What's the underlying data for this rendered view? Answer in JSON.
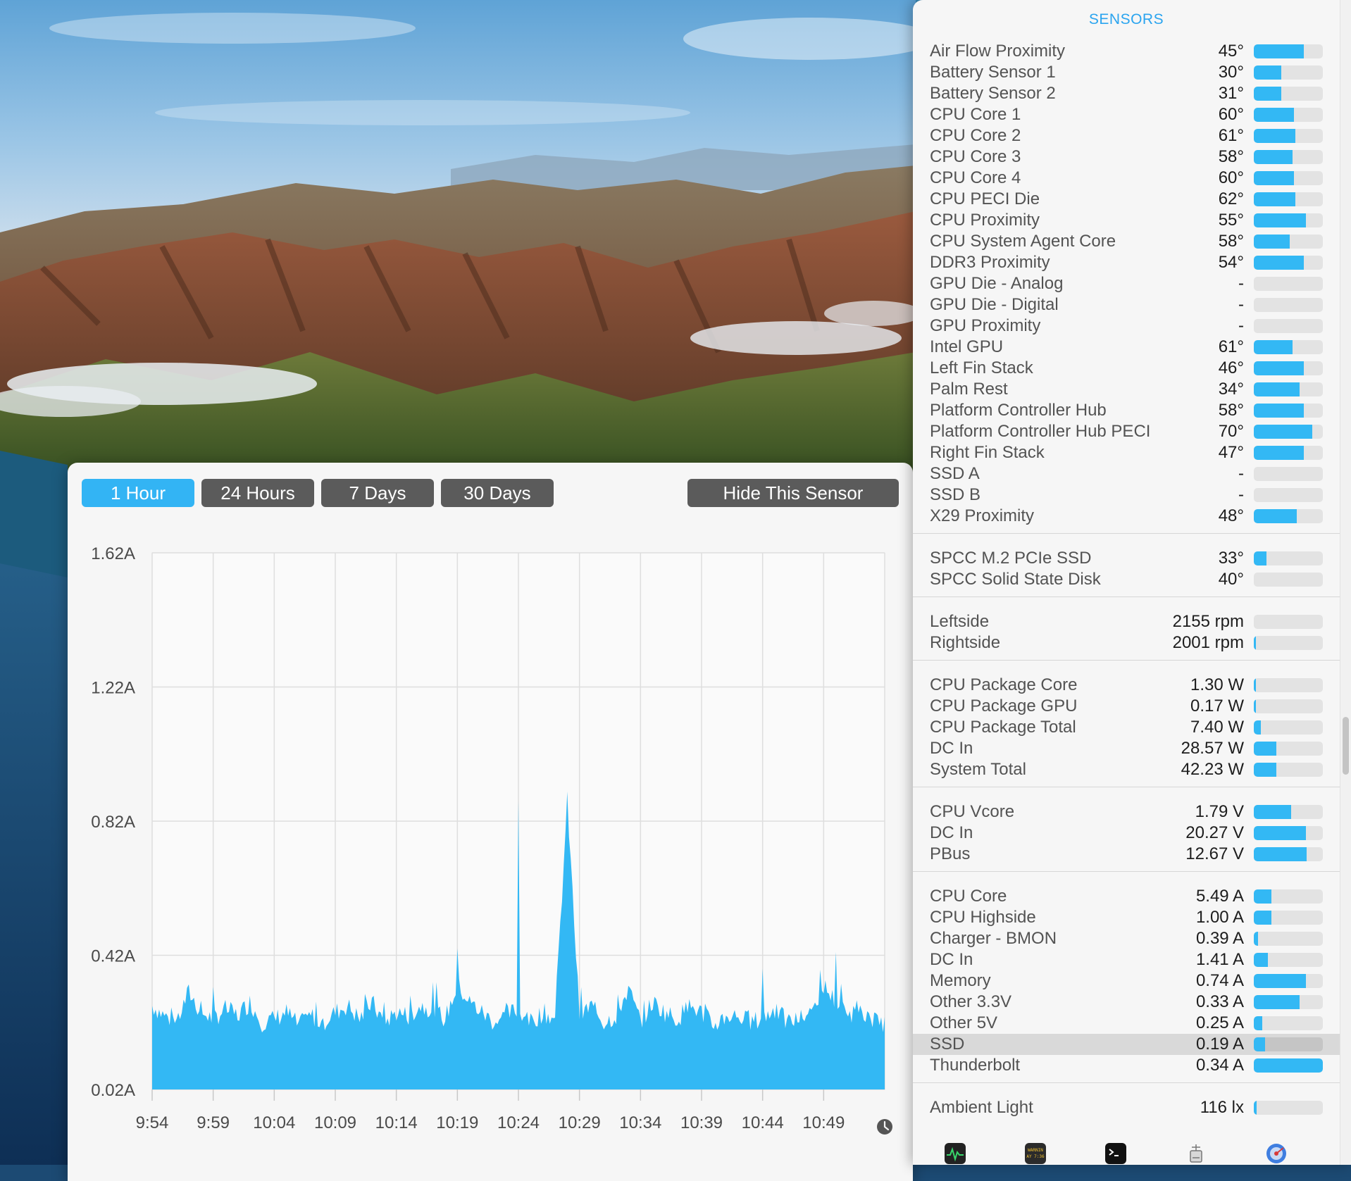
{
  "graph": {
    "range_buttons": [
      {
        "label": "1 Hour",
        "active": true
      },
      {
        "label": "24 Hours",
        "active": false
      },
      {
        "label": "7 Days",
        "active": false
      },
      {
        "label": "30 Days",
        "active": false
      }
    ],
    "hide_sensor_label": "Hide This Sensor",
    "y_ticks": [
      "1.62A",
      "1.22A",
      "0.82A",
      "0.42A",
      "0.02A"
    ],
    "x_ticks": [
      "9:54",
      "9:59",
      "10:04",
      "10:09",
      "10:14",
      "10:19",
      "10:24",
      "10:29",
      "10:34",
      "10:39",
      "10:44",
      "10:49"
    ],
    "clock_icon": "clock-icon",
    "fill_color": "#33b8f4"
  },
  "chart_data": {
    "type": "area",
    "title": "",
    "xlabel": "",
    "ylabel": "",
    "x_range": [
      "9:54",
      "10:54"
    ],
    "ylim": [
      0.02,
      1.62
    ],
    "unit": "A",
    "grid": true,
    "series": [
      {
        "x_minutes_from_start": [
          0,
          1,
          2,
          3,
          4,
          5,
          6,
          7,
          8,
          9,
          10,
          11,
          12,
          13,
          14,
          15,
          16,
          17,
          18,
          19,
          20,
          21,
          22,
          23,
          24,
          25,
          26,
          27,
          28,
          29,
          30,
          31,
          32,
          33,
          34,
          35,
          36,
          37,
          38,
          39,
          40,
          41,
          42,
          43,
          44,
          45,
          46,
          47,
          48,
          49,
          50,
          51,
          52,
          53,
          54,
          55,
          56,
          57,
          58,
          59,
          60
        ],
        "values": [
          0.27,
          0.24,
          0.22,
          0.31,
          0.25,
          0.23,
          0.26,
          0.24,
          0.28,
          0.22,
          0.23,
          0.25,
          0.21,
          0.24,
          0.22,
          0.25,
          0.27,
          0.23,
          0.28,
          0.22,
          0.25,
          0.24,
          0.27,
          0.26,
          0.23,
          0.33,
          0.28,
          0.25,
          0.22,
          0.24,
          0.26,
          0.22,
          0.25,
          0.23,
          0.88,
          0.24,
          0.27,
          0.22,
          0.24,
          0.32,
          0.22,
          0.28,
          0.25,
          0.23,
          0.27,
          0.25,
          0.21,
          0.24,
          0.24,
          0.22,
          0.23,
          0.26,
          0.22,
          0.23,
          0.25,
          0.33,
          0.28,
          0.24,
          0.27,
          0.22,
          0.22
        ]
      }
    ],
    "annotations": [
      {
        "x": "10:19",
        "value": 0.44
      },
      {
        "x": "10:24",
        "value": 0.88
      },
      {
        "x": "10:44",
        "value": 0.38
      },
      {
        "x": "10:50",
        "value": 0.43
      }
    ]
  },
  "sensors": {
    "title": "SENSORS",
    "groups": [
      {
        "rows": [
          {
            "name": "Air Flow Proximity",
            "value": "45°",
            "level": 0.72
          },
          {
            "name": "Battery Sensor 1",
            "value": "30°",
            "level": 0.4
          },
          {
            "name": "Battery Sensor 2",
            "value": "31°",
            "level": 0.4
          },
          {
            "name": "CPU Core 1",
            "value": "60°",
            "level": 0.58
          },
          {
            "name": "CPU Core 2",
            "value": "61°",
            "level": 0.6
          },
          {
            "name": "CPU Core 3",
            "value": "58°",
            "level": 0.56
          },
          {
            "name": "CPU Core 4",
            "value": "60°",
            "level": 0.58
          },
          {
            "name": "CPU PECI Die",
            "value": "62°",
            "level": 0.6
          },
          {
            "name": "CPU Proximity",
            "value": "55°",
            "level": 0.75
          },
          {
            "name": "CPU System Agent Core",
            "value": "58°",
            "level": 0.52
          },
          {
            "name": "DDR3 Proximity",
            "value": "54°",
            "level": 0.72
          },
          {
            "name": "GPU Die - Analog",
            "value": "-",
            "level": 0
          },
          {
            "name": "GPU Die - Digital",
            "value": "-",
            "level": 0
          },
          {
            "name": "GPU Proximity",
            "value": "-",
            "level": 0
          },
          {
            "name": "Intel GPU",
            "value": "61°",
            "level": 0.56
          },
          {
            "name": "Left Fin Stack",
            "value": "46°",
            "level": 0.72
          },
          {
            "name": "Palm Rest",
            "value": "34°",
            "level": 0.66
          },
          {
            "name": "Platform Controller Hub",
            "value": "58°",
            "level": 0.72
          },
          {
            "name": "Platform Controller Hub PECI",
            "value": "70°",
            "level": 0.85
          },
          {
            "name": "Right Fin Stack",
            "value": "47°",
            "level": 0.72
          },
          {
            "name": "SSD A",
            "value": "-",
            "level": 0
          },
          {
            "name": "SSD B",
            "value": "-",
            "level": 0
          },
          {
            "name": "X29 Proximity",
            "value": "48°",
            "level": 0.62
          }
        ]
      },
      {
        "rows": [
          {
            "name": "SPCC M.2 PCIe SSD",
            "value": "33°",
            "level": 0.18
          },
          {
            "name": "SPCC Solid State Disk",
            "value": "40°",
            "level": 0
          }
        ]
      },
      {
        "rows": [
          {
            "name": "Leftside",
            "value": "2155 rpm",
            "level": 0
          },
          {
            "name": "Rightside",
            "value": "2001 rpm",
            "level": 0.02
          }
        ]
      },
      {
        "rows": [
          {
            "name": "CPU Package Core",
            "value": "1.30 W",
            "level": 0.02
          },
          {
            "name": "CPU Package GPU",
            "value": "0.17 W",
            "level": 0.01
          },
          {
            "name": "CPU Package Total",
            "value": "7.40 W",
            "level": 0.1
          },
          {
            "name": "DC In",
            "value": "28.57 W",
            "level": 0.33
          },
          {
            "name": "System Total",
            "value": "42.23 W",
            "level": 0.33
          }
        ]
      },
      {
        "rows": [
          {
            "name": "CPU Vcore",
            "value": "1.79 V",
            "level": 0.54
          },
          {
            "name": "DC In",
            "value": "20.27 V",
            "level": 0.75
          },
          {
            "name": "PBus",
            "value": "12.67 V",
            "level": 0.77
          }
        ]
      },
      {
        "rows": [
          {
            "name": "CPU Core",
            "value": "5.49 A",
            "level": 0.25
          },
          {
            "name": "CPU Highside",
            "value": "1.00 A",
            "level": 0.25
          },
          {
            "name": "Charger - BMON",
            "value": "0.39 A",
            "level": 0.06
          },
          {
            "name": "DC In",
            "value": "1.41 A",
            "level": 0.2
          },
          {
            "name": "Memory",
            "value": "0.74 A",
            "level": 0.75
          },
          {
            "name": "Other 3.3V",
            "value": "0.33 A",
            "level": 0.66
          },
          {
            "name": "Other 5V",
            "value": "0.25 A",
            "level": 0.12
          },
          {
            "name": "SSD",
            "value": "0.19 A",
            "level": 0.16,
            "selected": true
          },
          {
            "name": "Thunderbolt",
            "value": "0.34 A",
            "level": 1.0
          }
        ]
      },
      {
        "rows": [
          {
            "name": "Ambient Light",
            "value": "116 lx",
            "level": 0.04
          }
        ]
      }
    ],
    "toolbar_icons": [
      "activity-monitor-icon",
      "console-icon",
      "terminal-icon",
      "system-information-icon",
      "disk-utility-icon"
    ],
    "toolbar_icon_texts": [
      "WARNIN",
      "AY 7:36"
    ]
  }
}
